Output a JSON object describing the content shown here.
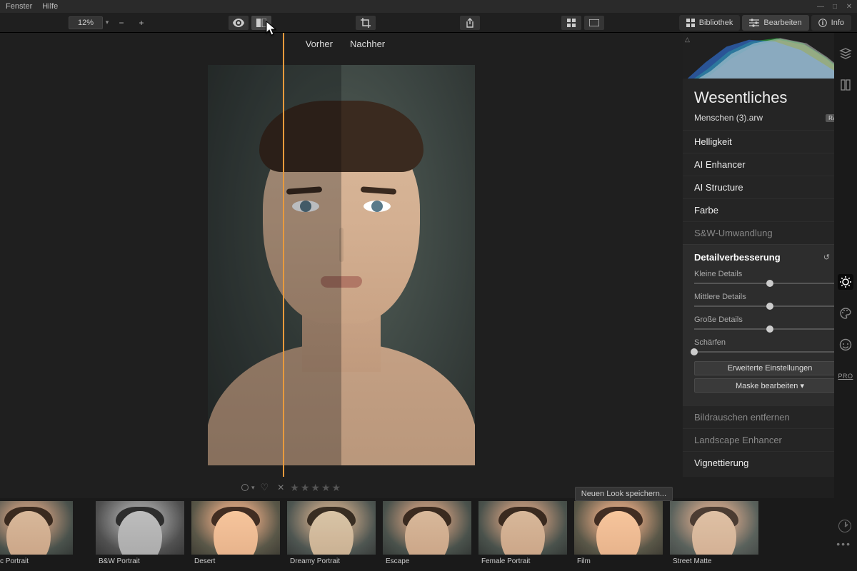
{
  "menubar": {
    "items": [
      "Fenster",
      "Hilfe"
    ]
  },
  "toolbar": {
    "zoom": "12%",
    "modes": {
      "library": "Bibliothek",
      "edit": "Bearbeiten",
      "info": "Info"
    }
  },
  "compare": {
    "before": "Vorher",
    "after": "Nachher"
  },
  "sidebar": {
    "title": "Wesentliches",
    "filename": "Menschen (3).arw",
    "raw_badge": "RAW",
    "sections": {
      "brightness": "Helligkeit",
      "ai_enhancer": "AI Enhancer",
      "ai_structure": "AI Structure",
      "color": "Farbe",
      "bw": "S&W-Umwandlung",
      "detail": "Detailverbesserung",
      "noise": "Bildrauschen entfernen",
      "landscape": "Landscape Enhancer",
      "vignette": "Vignettierung"
    },
    "sliders": {
      "small": {
        "label": "Kleine Details",
        "value": "0"
      },
      "mid": {
        "label": "Mittlere Details",
        "value": "0"
      },
      "large": {
        "label": "Große Details",
        "value": "0"
      },
      "sharp": {
        "label": "Schärfen",
        "value": "0"
      }
    },
    "buttons": {
      "advanced": "Erweiterte Einstellungen",
      "mask": "Maske bearbeiten ▾"
    }
  },
  "rail": {
    "pro": "PRO"
  },
  "saveLook": "Neuen Look speichern...",
  "filmstrip": [
    {
      "label": "c Portrait"
    },
    {
      "label": "B&W Portrait"
    },
    {
      "label": "Desert"
    },
    {
      "label": "Dreamy Portrait"
    },
    {
      "label": "Escape"
    },
    {
      "label": "Female Portrait"
    },
    {
      "label": "Film"
    },
    {
      "label": "Street Matte"
    }
  ]
}
